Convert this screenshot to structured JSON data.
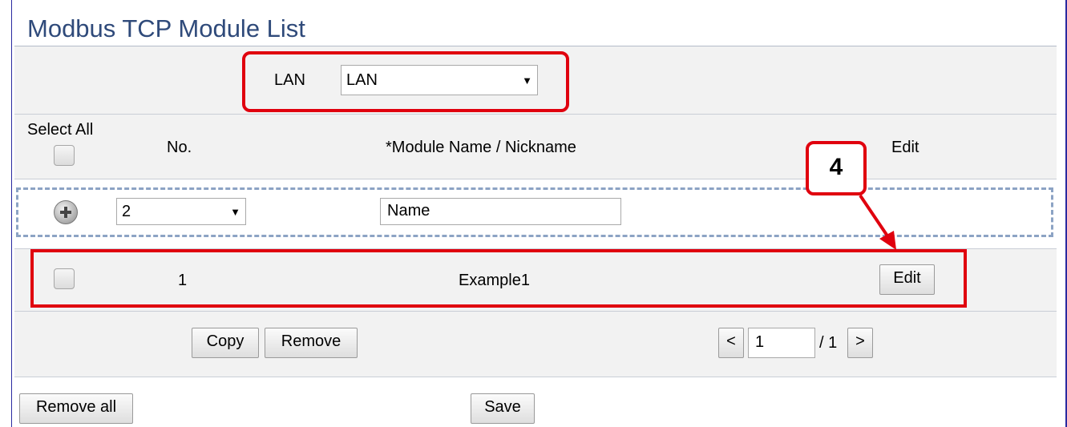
{
  "page": {
    "title": "Modbus TCP Module List"
  },
  "lan": {
    "label": "LAN",
    "selected": "LAN"
  },
  "table": {
    "headers": {
      "select_all": "Select All",
      "no": "No.",
      "module_name": "*Module Name / Nickname",
      "edit": "Edit"
    },
    "new_row": {
      "number_selected": "2",
      "name_value": "Name"
    },
    "rows": [
      {
        "no": "1",
        "name": "Example1",
        "edit_label": "Edit"
      }
    ]
  },
  "actions": {
    "copy_label": "Copy",
    "remove_label": "Remove"
  },
  "pagination": {
    "prev_label": "<",
    "page_value": "1",
    "total": "/ 1",
    "next_label": ">"
  },
  "footer": {
    "remove_all_label": "Remove all",
    "save_label": "Save"
  },
  "annotation": {
    "step_number": "4",
    "highlight_color": "#e0000e"
  }
}
